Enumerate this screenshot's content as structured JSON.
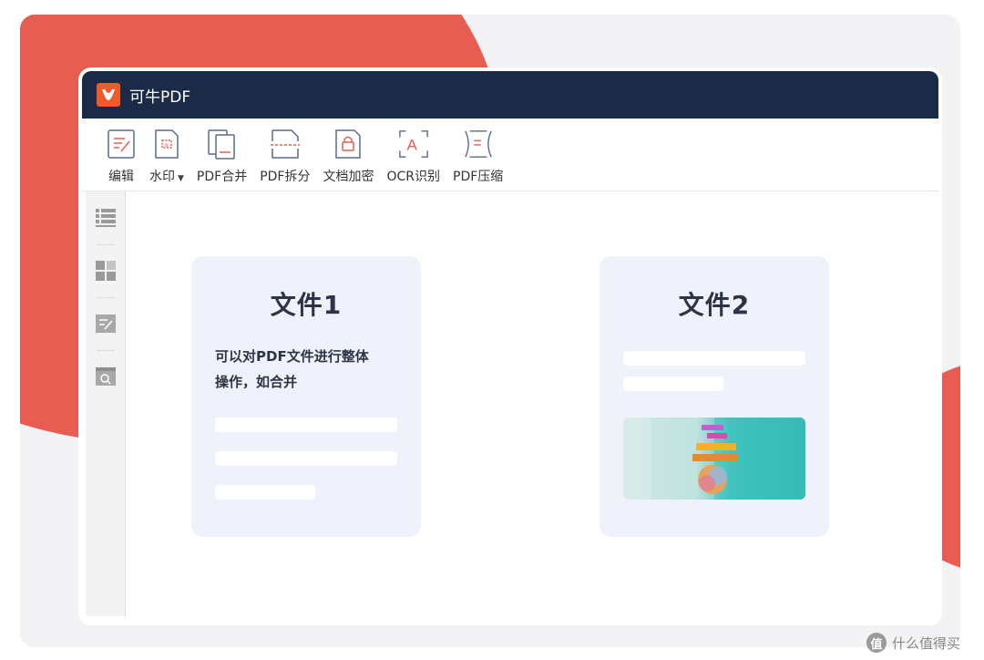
{
  "app": {
    "title": "可牛PDF"
  },
  "toolbar": {
    "items": [
      {
        "label": "编辑",
        "icon": "edit-icon"
      },
      {
        "label": "水印",
        "icon": "watermark-icon",
        "has_dropdown": true
      },
      {
        "label": "PDF合并",
        "icon": "merge-icon"
      },
      {
        "label": "PDF拆分",
        "icon": "split-icon"
      },
      {
        "label": "文档加密",
        "icon": "lock-icon"
      },
      {
        "label": "OCR识别",
        "icon": "ocr-icon"
      },
      {
        "label": "PDF压缩",
        "icon": "compress-icon"
      }
    ]
  },
  "sidebar": {
    "items": [
      {
        "icon": "list-icon"
      },
      {
        "icon": "thumbnail-grid-icon"
      },
      {
        "icon": "annotation-icon"
      },
      {
        "icon": "search-icon"
      }
    ]
  },
  "cards": [
    {
      "title": "文件1",
      "description_line1": "可以对PDF文件进行整体",
      "description_line2": "操作，如合并"
    },
    {
      "title": "文件2"
    }
  ],
  "watermark": {
    "symbol": "值",
    "text": "什么值得买"
  },
  "colors": {
    "accent": "#e85d52",
    "titlebar": "#1b2b47",
    "card": "#eff2fb",
    "logo": "#ef5a2d"
  }
}
